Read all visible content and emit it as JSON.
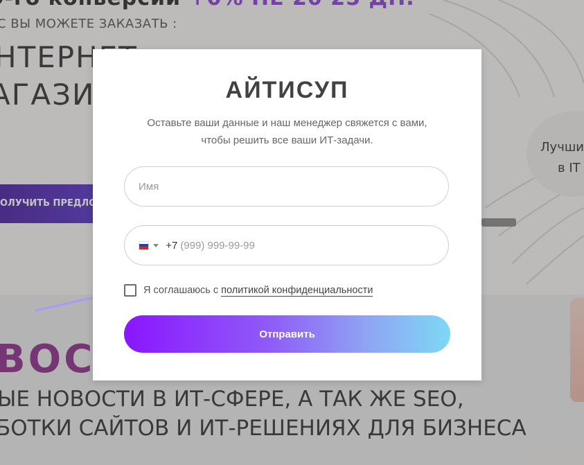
{
  "background": {
    "headline_part1": "О-го конверсии",
    "headline_accent": "+0% НЕ 20 25 ДН.",
    "subheading": "С ВЫ МОЖЕТЕ ЗАКАЗАТЬ :",
    "big_line1": "НТЕРНЕТ",
    "big_line2": "АГАЗИ",
    "cta_label": "ОЛУЧИТЬ ПРЕДЛО",
    "badge_line1": "Лучши",
    "badge_line2": "в IT",
    "news_title": "ВОСТ",
    "news_line1": "ЫЕ НОВОСТИ В ИТ-СФЕРЕ, А ТАК ЖЕ SEO,",
    "news_line2": "БОТКИ САЙТОВ И ИТ-РЕШЕНИЯХ ДЛЯ БИЗНЕСА"
  },
  "modal": {
    "title": "АЙТИСУП",
    "description": "Оставьте ваши данные и наш менеджер свяжется с вами, чтобы решить все ваши ИТ-задачи.",
    "name_field": {
      "value": "",
      "placeholder": "Имя"
    },
    "phone_field": {
      "country_flag": "russia-flag-icon",
      "code": "+7",
      "value": "",
      "placeholder": "(999) 999-99-99"
    },
    "consent": {
      "checked": false,
      "text": "Я соглашаюсь с",
      "link_text": "политикой конфиденциальности"
    },
    "submit_label": "Отправить"
  },
  "colors": {
    "accent_purple": "#8a16ff",
    "gradient_end": "#7dd8f6",
    "pointer_arrow": "#a99af7"
  }
}
